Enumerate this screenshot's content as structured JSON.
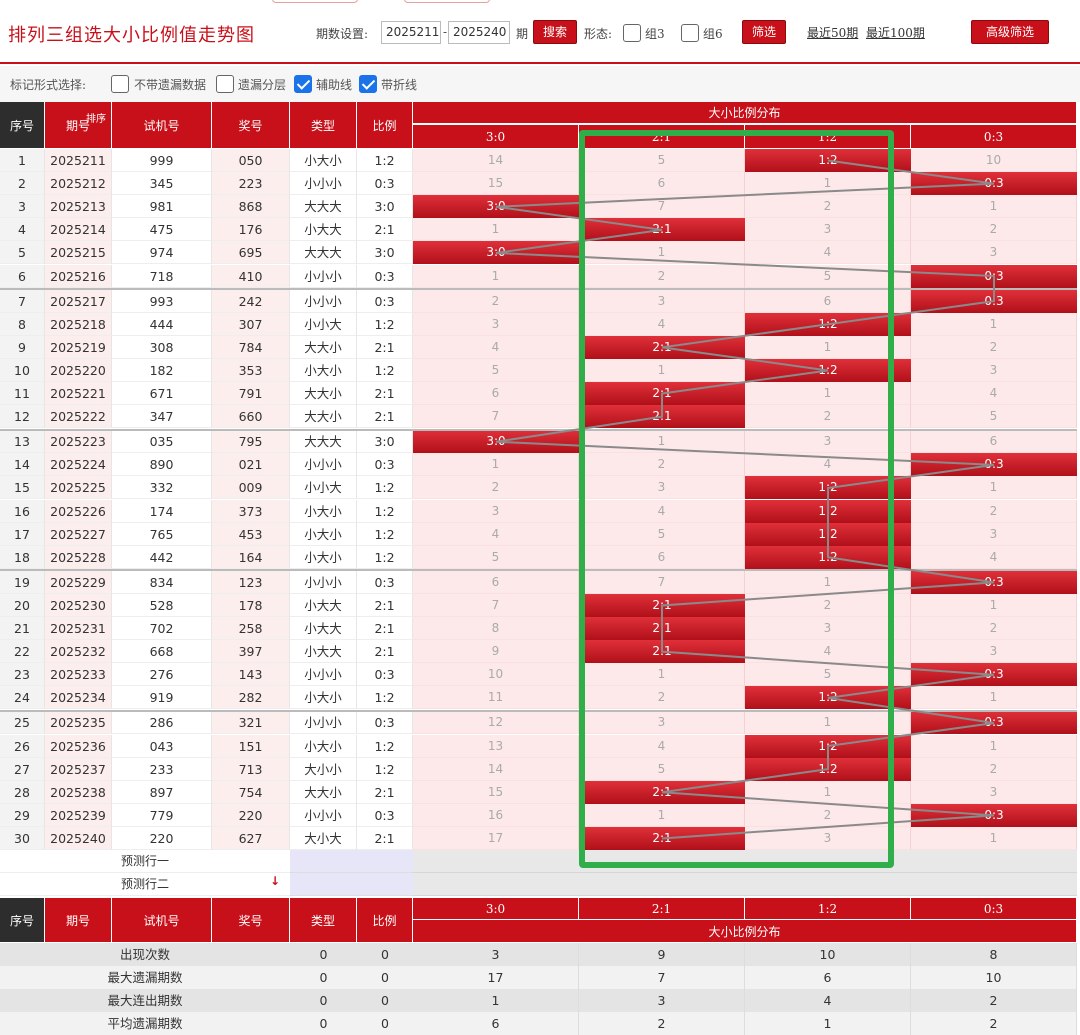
{
  "header": {
    "title": "排列三组选大小比例值走势图",
    "period_label": "期数设置:",
    "start_period": "2025211",
    "dash": "-",
    "end_period": "2025240",
    "period_suffix": "期",
    "search_label": "搜索",
    "form_label": "形态:",
    "group3_label": "组3",
    "group6_label": "组6",
    "filter_label": "筛选",
    "recent50_label": "最近50期",
    "recent100_label": "最近100期",
    "advanced_label": "高级筛选"
  },
  "mark_options": {
    "label": "标记形式选择:",
    "options": [
      {
        "label": "不带遗漏数据",
        "checked": false
      },
      {
        "label": "遗漏分层",
        "checked": false
      },
      {
        "label": "辅助线",
        "checked": true
      },
      {
        "label": "带折线",
        "checked": true
      }
    ]
  },
  "table_header": {
    "col_index": "序号",
    "col_period": "期号",
    "col_sort": "排序",
    "col_trial": "试机号",
    "col_prize": "奖号",
    "col_type": "类型",
    "col_ratio": "比例",
    "dist_title": "大小比例分布",
    "dist_cols": [
      "3:0",
      "2:1",
      "1:2",
      "0:3"
    ]
  },
  "rows": [
    {
      "idx": "1",
      "period": "2025211",
      "trial": "999",
      "prize": "050",
      "type": "小大小",
      "ratio": "1:2",
      "dist": [
        "14",
        "5",
        "1:2",
        "10"
      ],
      "hit": 2
    },
    {
      "idx": "2",
      "period": "2025212",
      "trial": "345",
      "prize": "223",
      "type": "小小小",
      "ratio": "0:3",
      "dist": [
        "15",
        "6",
        "1",
        "0:3"
      ],
      "hit": 3
    },
    {
      "idx": "3",
      "period": "2025213",
      "trial": "981",
      "prize": "868",
      "type": "大大大",
      "ratio": "3:0",
      "dist": [
        "3:0",
        "7",
        "2",
        "1"
      ],
      "hit": 0
    },
    {
      "idx": "4",
      "period": "2025214",
      "trial": "475",
      "prize": "176",
      "type": "小大大",
      "ratio": "2:1",
      "dist": [
        "1",
        "2:1",
        "3",
        "2"
      ],
      "hit": 1
    },
    {
      "idx": "5",
      "period": "2025215",
      "trial": "974",
      "prize": "695",
      "type": "大大大",
      "ratio": "3:0",
      "dist": [
        "3:0",
        "1",
        "4",
        "3"
      ],
      "hit": 0
    },
    {
      "idx": "6",
      "period": "2025216",
      "trial": "718",
      "prize": "410",
      "type": "小小小",
      "ratio": "0:3",
      "dist": [
        "1",
        "2",
        "5",
        "0:3"
      ],
      "hit": 3
    },
    {
      "idx": "7",
      "period": "2025217",
      "trial": "993",
      "prize": "242",
      "type": "小小小",
      "ratio": "0:3",
      "dist": [
        "2",
        "3",
        "6",
        "0:3"
      ],
      "hit": 3
    },
    {
      "idx": "8",
      "period": "2025218",
      "trial": "444",
      "prize": "307",
      "type": "小小大",
      "ratio": "1:2",
      "dist": [
        "3",
        "4",
        "1:2",
        "1"
      ],
      "hit": 2
    },
    {
      "idx": "9",
      "period": "2025219",
      "trial": "308",
      "prize": "784",
      "type": "大大小",
      "ratio": "2:1",
      "dist": [
        "4",
        "2:1",
        "1",
        "2"
      ],
      "hit": 1
    },
    {
      "idx": "10",
      "period": "2025220",
      "trial": "182",
      "prize": "353",
      "type": "小大小",
      "ratio": "1:2",
      "dist": [
        "5",
        "1",
        "1:2",
        "3"
      ],
      "hit": 2
    },
    {
      "idx": "11",
      "period": "2025221",
      "trial": "671",
      "prize": "791",
      "type": "大大小",
      "ratio": "2:1",
      "dist": [
        "6",
        "2:1",
        "1",
        "4"
      ],
      "hit": 1
    },
    {
      "idx": "12",
      "period": "2025222",
      "trial": "347",
      "prize": "660",
      "type": "大大小",
      "ratio": "2:1",
      "dist": [
        "7",
        "2:1",
        "2",
        "5"
      ],
      "hit": 1
    },
    {
      "idx": "13",
      "period": "2025223",
      "trial": "035",
      "prize": "795",
      "type": "大大大",
      "ratio": "3:0",
      "dist": [
        "3:0",
        "1",
        "3",
        "6"
      ],
      "hit": 0
    },
    {
      "idx": "14",
      "period": "2025224",
      "trial": "890",
      "prize": "021",
      "type": "小小小",
      "ratio": "0:3",
      "dist": [
        "1",
        "2",
        "4",
        "0:3"
      ],
      "hit": 3
    },
    {
      "idx": "15",
      "period": "2025225",
      "trial": "332",
      "prize": "009",
      "type": "小小大",
      "ratio": "1:2",
      "dist": [
        "2",
        "3",
        "1:2",
        "1"
      ],
      "hit": 2
    },
    {
      "idx": "16",
      "period": "2025226",
      "trial": "174",
      "prize": "373",
      "type": "小大小",
      "ratio": "1:2",
      "dist": [
        "3",
        "4",
        "1:2",
        "2"
      ],
      "hit": 2
    },
    {
      "idx": "17",
      "period": "2025227",
      "trial": "765",
      "prize": "453",
      "type": "小大小",
      "ratio": "1:2",
      "dist": [
        "4",
        "5",
        "1:2",
        "3"
      ],
      "hit": 2
    },
    {
      "idx": "18",
      "period": "2025228",
      "trial": "442",
      "prize": "164",
      "type": "小大小",
      "ratio": "1:2",
      "dist": [
        "5",
        "6",
        "1:2",
        "4"
      ],
      "hit": 2
    },
    {
      "idx": "19",
      "period": "2025229",
      "trial": "834",
      "prize": "123",
      "type": "小小小",
      "ratio": "0:3",
      "dist": [
        "6",
        "7",
        "1",
        "0:3"
      ],
      "hit": 3
    },
    {
      "idx": "20",
      "period": "2025230",
      "trial": "528",
      "prize": "178",
      "type": "小大大",
      "ratio": "2:1",
      "dist": [
        "7",
        "2:1",
        "2",
        "1"
      ],
      "hit": 1
    },
    {
      "idx": "21",
      "period": "2025231",
      "trial": "702",
      "prize": "258",
      "type": "小大大",
      "ratio": "2:1",
      "dist": [
        "8",
        "2:1",
        "3",
        "2"
      ],
      "hit": 1
    },
    {
      "idx": "22",
      "period": "2025232",
      "trial": "668",
      "prize": "397",
      "type": "小大大",
      "ratio": "2:1",
      "dist": [
        "9",
        "2:1",
        "4",
        "3"
      ],
      "hit": 1
    },
    {
      "idx": "23",
      "period": "2025233",
      "trial": "276",
      "prize": "143",
      "type": "小小小",
      "ratio": "0:3",
      "dist": [
        "10",
        "1",
        "5",
        "0:3"
      ],
      "hit": 3
    },
    {
      "idx": "24",
      "period": "2025234",
      "trial": "919",
      "prize": "282",
      "type": "小大小",
      "ratio": "1:2",
      "dist": [
        "11",
        "2",
        "1:2",
        "1"
      ],
      "hit": 2
    },
    {
      "idx": "25",
      "period": "2025235",
      "trial": "286",
      "prize": "321",
      "type": "小小小",
      "ratio": "0:3",
      "dist": [
        "12",
        "3",
        "1",
        "0:3"
      ],
      "hit": 3
    },
    {
      "idx": "26",
      "period": "2025236",
      "trial": "043",
      "prize": "151",
      "type": "小大小",
      "ratio": "1:2",
      "dist": [
        "13",
        "4",
        "1:2",
        "1"
      ],
      "hit": 2
    },
    {
      "idx": "27",
      "period": "2025237",
      "trial": "233",
      "prize": "713",
      "type": "大小小",
      "ratio": "1:2",
      "dist": [
        "14",
        "5",
        "1:2",
        "2"
      ],
      "hit": 2
    },
    {
      "idx": "28",
      "period": "2025238",
      "trial": "897",
      "prize": "754",
      "type": "大大小",
      "ratio": "2:1",
      "dist": [
        "15",
        "2:1",
        "1",
        "3"
      ],
      "hit": 1
    },
    {
      "idx": "29",
      "period": "2025239",
      "trial": "779",
      "prize": "220",
      "type": "小小小",
      "ratio": "0:3",
      "dist": [
        "16",
        "1",
        "2",
        "0:3"
      ],
      "hit": 3
    },
    {
      "idx": "30",
      "period": "2025240",
      "trial": "220",
      "prize": "627",
      "type": "大小大",
      "ratio": "2:1",
      "dist": [
        "17",
        "2:1",
        "3",
        "1"
      ],
      "hit": 1
    }
  ],
  "predict": {
    "row1": "预测行一",
    "row2": "预测行二"
  },
  "stats": [
    {
      "label": "出现次数",
      "type": "0",
      "ratio": "0",
      "vals": [
        "3",
        "9",
        "10",
        "8"
      ]
    },
    {
      "label": "最大遗漏期数",
      "type": "0",
      "ratio": "0",
      "vals": [
        "17",
        "7",
        "6",
        "10"
      ]
    },
    {
      "label": "最大连出期数",
      "type": "0",
      "ratio": "0",
      "vals": [
        "1",
        "3",
        "4",
        "2"
      ]
    },
    {
      "label": "平均遗漏期数",
      "type": "0",
      "ratio": "0",
      "vals": [
        "6",
        "2",
        "1",
        "2"
      ]
    }
  ],
  "colors": {
    "accent": "#c8101a",
    "highlight_box": "#2fae4a",
    "row_pink": "#fde9ea"
  }
}
